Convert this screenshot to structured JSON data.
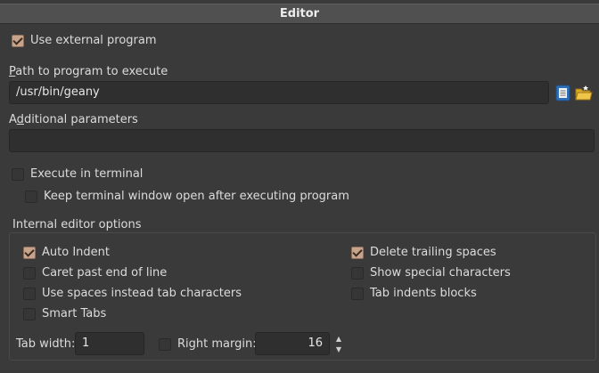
{
  "title": "Editor",
  "use_external_program": {
    "label": "Use external program",
    "checked": true
  },
  "path": {
    "label_first": "P",
    "label_rest": "ath to program to execute",
    "value": "/usr/bin/geany",
    "icons": [
      "document-icon",
      "open-folder-icon"
    ]
  },
  "additional_parameters": {
    "label_first": "A",
    "label_second": "d",
    "label_rest": "ditional parameters",
    "value": ""
  },
  "execute_in_terminal": {
    "label": "Execute in terminal",
    "checked": false
  },
  "keep_terminal_open": {
    "label": "Keep terminal window open after executing program",
    "checked": false
  },
  "internal_options": {
    "title": "Internal editor options",
    "left": [
      {
        "label": "Auto Indent",
        "checked": true
      },
      {
        "label": "Caret past end of line",
        "checked": false
      },
      {
        "label": "Use spaces instead tab characters",
        "checked": false
      },
      {
        "label": "Smart Tabs",
        "checked": false
      }
    ],
    "right": [
      {
        "label": "Delete trailing spaces",
        "checked": true
      },
      {
        "label": "Show special characters",
        "checked": false
      },
      {
        "label": "Tab indents blocks",
        "checked": false
      }
    ],
    "tab_width": {
      "label": "Tab width:",
      "value": "1"
    },
    "right_margin": {
      "label": "Right margin:",
      "value": "16",
      "checked": false
    }
  },
  "colors": {
    "accent_checkbox": "#c7a48a",
    "background": "#3a3a3a",
    "field": "#2f2f2f"
  }
}
